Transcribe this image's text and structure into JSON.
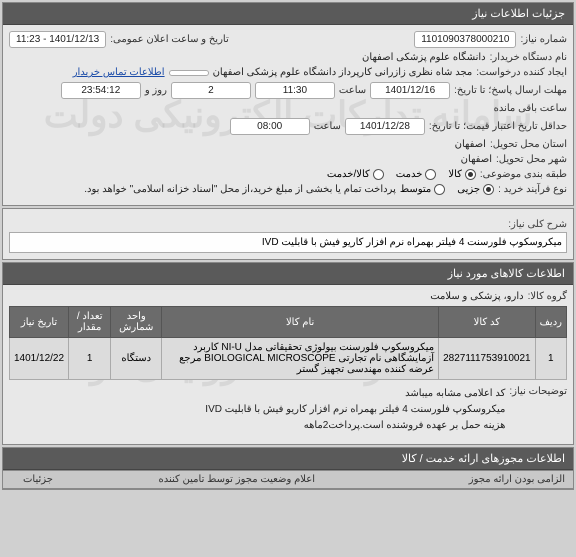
{
  "header": {
    "title": "جزئیات اطلاعات نیاز"
  },
  "watermark": "سامانه تدارکات الکترونیکی دولت",
  "info": {
    "need_number_label": "شماره نیاز:",
    "need_number": "1101090378000210",
    "announce_label": "تاریخ و ساعت اعلان عمومی:",
    "announce_value": "1401/12/13 - 11:23",
    "buyer_org_label": "نام دستگاه خریدار:",
    "buyer_org": "دانشگاه علوم پزشکی اصفهان",
    "creator_label": "ایجاد کننده درخواست:",
    "creator": "مجد شاه نظری زازرانی کارپرداز دانشگاه علوم پزشکی اصفهان",
    "contact_link": "اطلاعات تماس خریدار",
    "deadline_label": "مهلت ارسال پاسخ؛ تا تاریخ:",
    "deadline_date": "1401/12/16",
    "deadline_time_label": "ساعت",
    "deadline_time": "11:30",
    "days_sep": "روز و",
    "days_remain": "2",
    "time_remain": "23:54:12",
    "remain_label": "ساعت باقی مانده",
    "valid_label": "حداقل تاریخ اعتبار قیمت؛ تا تاریخ:",
    "valid_date": "1401/12/28",
    "valid_time_label": "ساعت",
    "valid_time": "08:00",
    "delivery_province_label": "استان محل تحویل:",
    "delivery_province": "اصفهان",
    "delivery_city_label": "شهر محل تحویل:",
    "delivery_city": "اصفهان",
    "budget_label": "طبقه بندی موضوعی:",
    "budget_options": [
      "کالا",
      "خدمت",
      "کالا/خدمت"
    ],
    "budget_selected": 0,
    "process_label": "نوع فرآیند خرید :",
    "process_options": [
      "جزیی",
      "متوسط"
    ],
    "process_selected": 0,
    "process_note": "پرداخت تمام یا بخشی از مبلغ خرید،از محل \"اسناد خزانه اسلامی\" خواهد بود."
  },
  "need_desc": {
    "label": "شرح کلی نیاز:",
    "text": "میکروسکوپ فلورسنت 4 فیلتر بهمراه نرم افزار کاریو فیش با قابلیت IVD"
  },
  "items_header": "اطلاعات کالاهای مورد نیاز",
  "group": {
    "label": "گروه کالا:",
    "value": "دارو، پزشکی و سلامت"
  },
  "table": {
    "headers": [
      "ردیف",
      "کد کالا",
      "نام کالا",
      "واحد شمارش",
      "تعداد / مقدار",
      "تاریخ نیاز"
    ],
    "rows": [
      {
        "idx": "1",
        "code": "2827111753910021",
        "name": "میکروسکوپ فلورسنت بیولوژی تحقیقاتی مدل NI-U کاربرد آزمایشگاهی نام تجارتی BIOLOGICAL MICROSCOPE مرجع عرضه کننده مهندسی تجهیز گستر",
        "unit": "دستگاه",
        "qty": "1",
        "date": "1401/12/22"
      }
    ]
  },
  "notes": {
    "label": "توضیحات نیاز:",
    "lines": [
      "کد اعلامی مشابه میباشد",
      "میکروسکوپ فلورسنت 4 فیلتر بهمراه نرم افزار کاریو فیش با قابلیت IVD",
      "هزینه حمل بر عهده فروشنده است.پرداخت2ماهه"
    ]
  },
  "permits_header": "اطلاعات مجوزهای ارائه خدمت / کالا",
  "status_header": "اعلام وضعیت مجوز توسط تامین کننده",
  "details_tab": "جزئیات",
  "footer": {
    "mandatory_label": "الزامی بودن ارائه مجوز"
  }
}
